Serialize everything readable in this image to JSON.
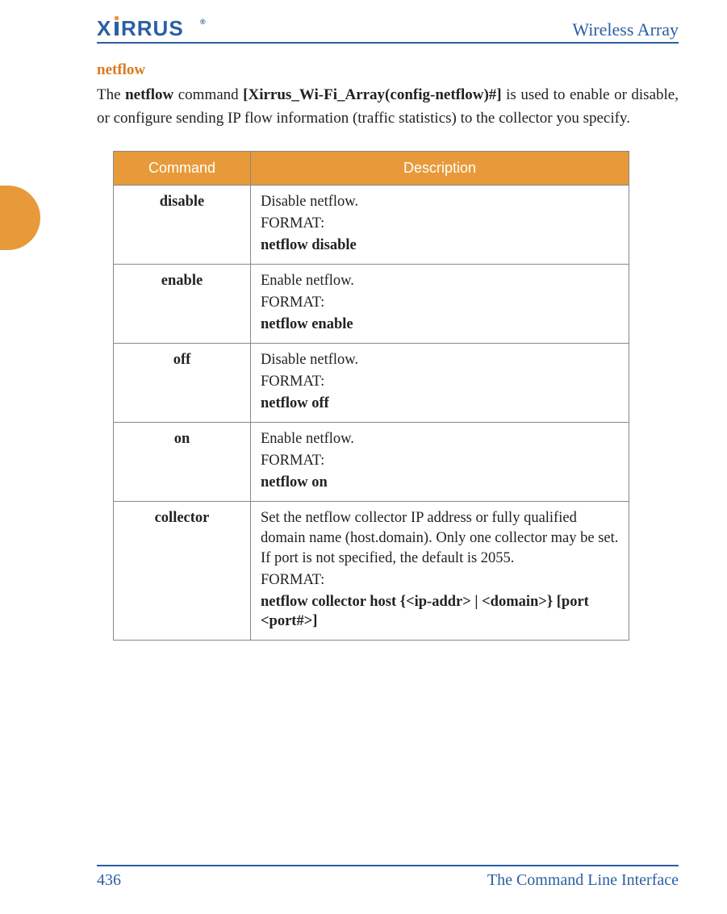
{
  "header": {
    "logo_text": "XIRRUS",
    "title": "Wireless Array"
  },
  "section": {
    "heading": "netflow",
    "intro_pre": "The ",
    "intro_cmd": "netflow",
    "intro_mid": " command ",
    "intro_prompt": "[Xirrus_Wi-Fi_Array(config-netflow)#]",
    "intro_post": " is used to enable or disable, or configure sending IP flow information (traffic statistics) to the collector you specify."
  },
  "table": {
    "headers": {
      "command": "Command",
      "description": "Description"
    },
    "rows": [
      {
        "command": "disable",
        "description": "Disable netflow.",
        "format_label": "FORMAT:",
        "format": "netflow disable"
      },
      {
        "command": "enable",
        "description": "Enable netflow.",
        "format_label": "FORMAT:",
        "format": "netflow enable"
      },
      {
        "command": "off",
        "description": "Disable netflow.",
        "format_label": "FORMAT:",
        "format": "netflow off"
      },
      {
        "command": "on",
        "description": "Enable netflow.",
        "format_label": "FORMAT:",
        "format": "netflow on"
      },
      {
        "command": "collector",
        "description": "Set the netflow collector IP address or fully qualified domain name (host.domain). Only one collector may be set. If port is not specified, the default is 2055.",
        "format_label": "FORMAT:",
        "format": "netflow collector host {<ip-addr> | <domain>} [port <port#>]"
      }
    ]
  },
  "footer": {
    "page": "436",
    "chapter": "The Command Line Interface"
  }
}
